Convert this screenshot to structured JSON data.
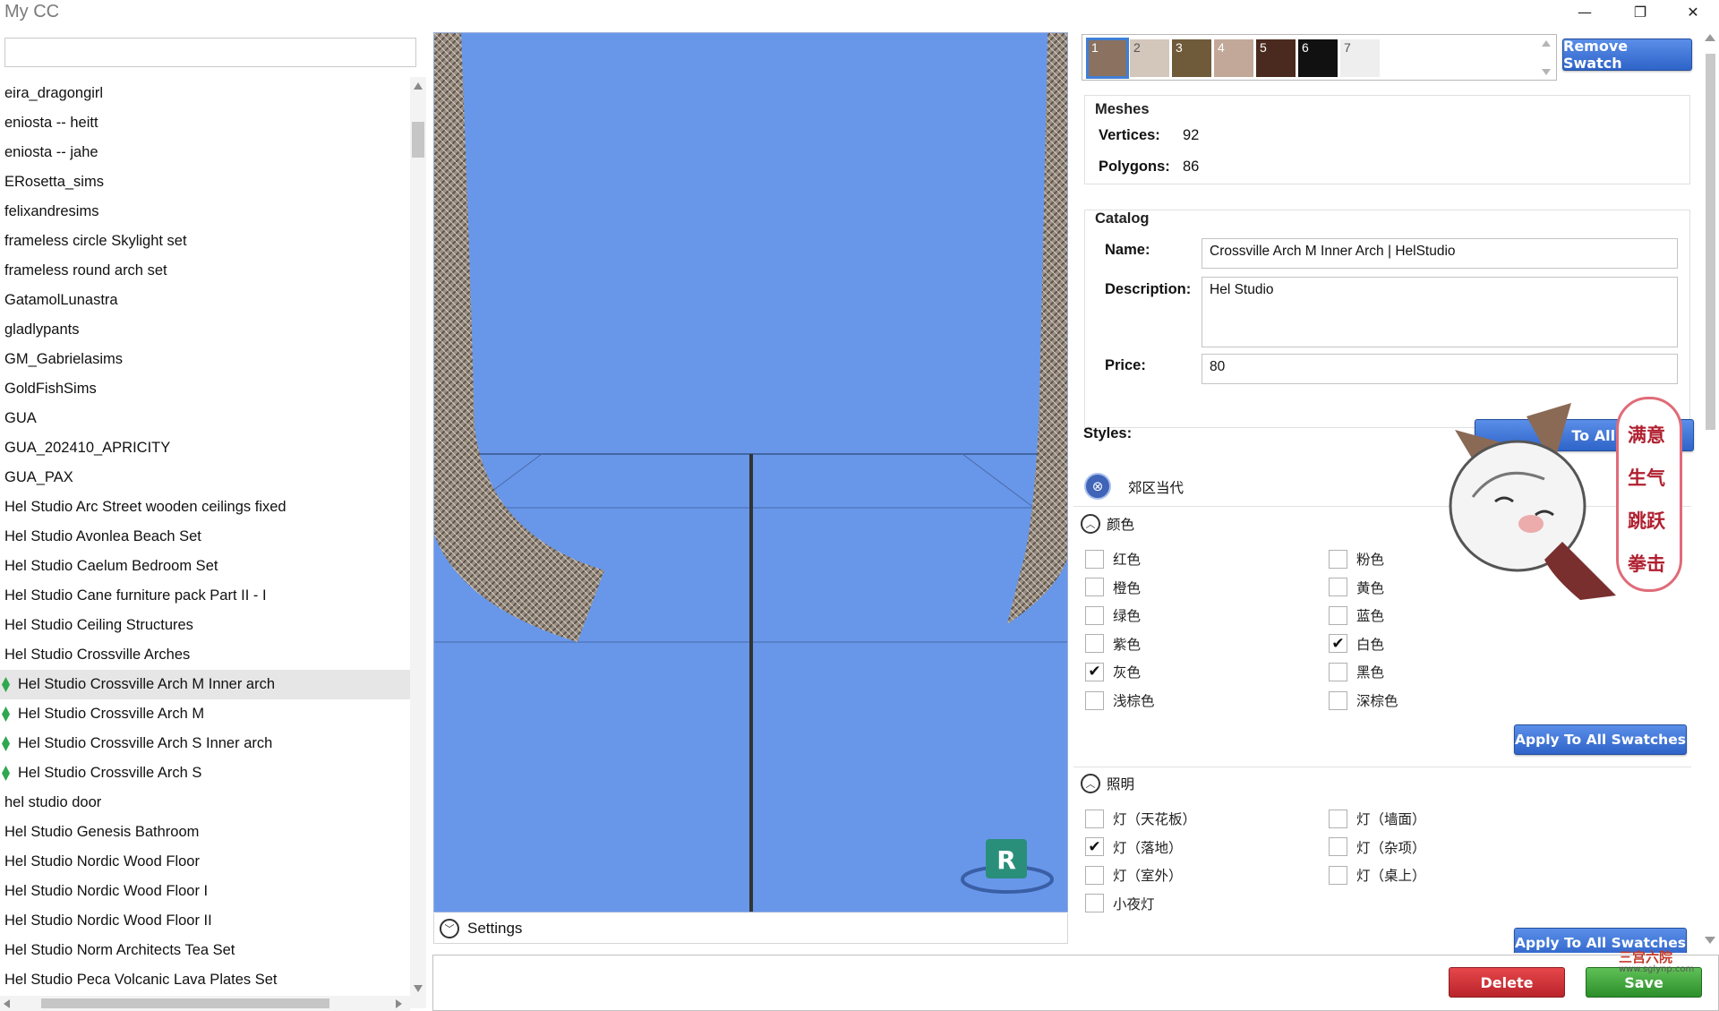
{
  "window": {
    "title": "My CC",
    "minimize": "—",
    "maximize": "❐",
    "close": "✕"
  },
  "search": {
    "value": "",
    "placeholder": ""
  },
  "cc_list": [
    {
      "label": "eira_dragongirl",
      "gem": false,
      "selected": false
    },
    {
      "label": "eniosta -- heitt",
      "gem": false,
      "selected": false
    },
    {
      "label": "eniosta -- jahe",
      "gem": false,
      "selected": false
    },
    {
      "label": "ERosetta_sims",
      "gem": false,
      "selected": false
    },
    {
      "label": "felixandresims",
      "gem": false,
      "selected": false
    },
    {
      "label": "frameless circle Skylight set",
      "gem": false,
      "selected": false
    },
    {
      "label": "frameless round arch set",
      "gem": false,
      "selected": false
    },
    {
      "label": "GatamolLunastra",
      "gem": false,
      "selected": false
    },
    {
      "label": "gladlypants",
      "gem": false,
      "selected": false
    },
    {
      "label": "GM_Gabrielasims",
      "gem": false,
      "selected": false
    },
    {
      "label": "GoldFishSims",
      "gem": false,
      "selected": false
    },
    {
      "label": "GUA",
      "gem": false,
      "selected": false
    },
    {
      "label": "GUA_202410_APRICITY",
      "gem": false,
      "selected": false
    },
    {
      "label": "GUA_PAX",
      "gem": false,
      "selected": false
    },
    {
      "label": "Hel Studio Arc Street wooden ceilings fixed",
      "gem": false,
      "selected": false
    },
    {
      "label": "Hel Studio Avonlea Beach Set",
      "gem": false,
      "selected": false
    },
    {
      "label": "Hel Studio Caelum Bedroom Set",
      "gem": false,
      "selected": false
    },
    {
      "label": "Hel Studio Cane furniture pack Part II - I",
      "gem": false,
      "selected": false
    },
    {
      "label": "Hel Studio Ceiling Structures",
      "gem": false,
      "selected": false
    },
    {
      "label": "Hel Studio Crossville Arches",
      "gem": false,
      "selected": false
    },
    {
      "label": "Hel Studio Crossville Arch M Inner arch",
      "gem": true,
      "selected": true
    },
    {
      "label": "Hel Studio Crossville Arch M",
      "gem": true,
      "selected": false
    },
    {
      "label": "Hel Studio Crossville Arch S Inner arch",
      "gem": true,
      "selected": false
    },
    {
      "label": "Hel Studio Crossville Arch S",
      "gem": true,
      "selected": false
    },
    {
      "label": "hel studio door",
      "gem": false,
      "selected": false
    },
    {
      "label": "Hel Studio Genesis Bathroom",
      "gem": false,
      "selected": false
    },
    {
      "label": "Hel Studio Nordic Wood Floor",
      "gem": false,
      "selected": false
    },
    {
      "label": "Hel Studio Nordic Wood Floor I",
      "gem": false,
      "selected": false
    },
    {
      "label": "Hel Studio Nordic Wood Floor II",
      "gem": false,
      "selected": false
    },
    {
      "label": "Hel Studio Norm Architects Tea Set",
      "gem": false,
      "selected": false
    },
    {
      "label": "Hel Studio Peca Volcanic Lava Plates Set",
      "gem": false,
      "selected": false
    }
  ],
  "viewport": {
    "background": "#6897ea",
    "settings_label": "Settings",
    "badge_letter": "R"
  },
  "swatches": [
    {
      "num": "1",
      "color": "#8a7160",
      "selected": true
    },
    {
      "num": "2",
      "color": "#d3c6bb",
      "selected": false
    },
    {
      "num": "3",
      "color": "#6f5a3a",
      "selected": false
    },
    {
      "num": "4",
      "color": "#c2a898",
      "selected": false
    },
    {
      "num": "5",
      "color": "#4a2a1e",
      "selected": false
    },
    {
      "num": "6",
      "color": "#111111",
      "selected": false
    },
    {
      "num": "7",
      "color": "#eeeeee",
      "selected": false
    }
  ],
  "remove_swatch": "Remove Swatch",
  "meshes": {
    "title": "Meshes",
    "vertices_label": "Vertices:",
    "vertices": "92",
    "polygons_label": "Polygons:",
    "polygons": "86"
  },
  "catalog": {
    "title": "Catalog",
    "name_label": "Name:",
    "name": "Crossville Arch M Inner Arch | HelStudio",
    "description_label": "Description:",
    "description": "Hel Studio",
    "price_label": "Price:",
    "price": "80"
  },
  "styles": {
    "label": "Styles:",
    "apply_partial": "To All",
    "apply_partial_tail": "s",
    "style_name": "郊区当代",
    "remove_icon": "⊗"
  },
  "colors": {
    "title": "颜色",
    "options": [
      {
        "label": "红色",
        "checked": false
      },
      {
        "label": "粉色",
        "checked": false
      },
      {
        "label": "橙色",
        "checked": false
      },
      {
        "label": "黄色",
        "checked": false
      },
      {
        "label": "绿色",
        "checked": false
      },
      {
        "label": "蓝色",
        "checked": false
      },
      {
        "label": "紫色",
        "checked": false
      },
      {
        "label": "白色",
        "checked": true
      },
      {
        "label": "灰色",
        "checked": true
      },
      {
        "label": "黑色",
        "checked": false
      },
      {
        "label": "浅棕色",
        "checked": false
      },
      {
        "label": "深棕色",
        "checked": false
      }
    ],
    "apply": "Apply To All Swatches"
  },
  "lighting": {
    "title": "照明",
    "options": [
      {
        "label": "灯（天花板）",
        "checked": false
      },
      {
        "label": "灯（墙面）",
        "checked": false
      },
      {
        "label": "灯（落地）",
        "checked": true
      },
      {
        "label": "灯（杂项）",
        "checked": false
      },
      {
        "label": "灯（室外）",
        "checked": false
      },
      {
        "label": "灯（桌上）",
        "checked": false
      },
      {
        "label": "小夜灯",
        "checked": false
      }
    ],
    "apply": "Apply To All Swatches"
  },
  "actions": {
    "delete": "Delete",
    "save": "Save"
  },
  "overlay": {
    "words": [
      "满意",
      "生气",
      "跳跃",
      "拳击"
    ],
    "watermark_text": "三宫六院",
    "watermark_url": "www.sglynp.com"
  },
  "check_mark": "✔",
  "chevron_up": "︿",
  "chevron_down": "﹀"
}
